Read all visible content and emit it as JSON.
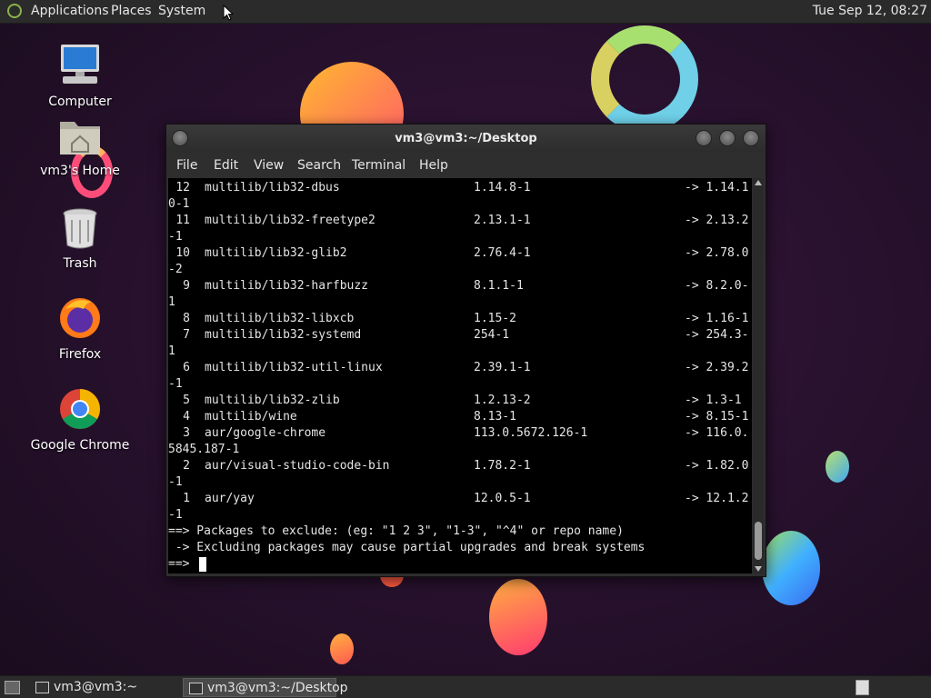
{
  "top_panel": {
    "menus": [
      "Applications",
      "Places",
      "System"
    ],
    "clock": "Tue Sep 12, 08:27"
  },
  "desktop_icons": [
    {
      "label": "Computer",
      "icon": "computer-icon"
    },
    {
      "label": "vm3's Home",
      "icon": "home-folder-icon"
    },
    {
      "label": "Trash",
      "icon": "trash-icon"
    },
    {
      "label": "Firefox",
      "icon": "firefox-icon"
    },
    {
      "label": "Google Chrome",
      "icon": "chrome-icon"
    }
  ],
  "terminal": {
    "title": "vm3@vm3:~/Desktop",
    "menu": [
      "File",
      "Edit",
      "View",
      "Search",
      "Terminal",
      "Help"
    ],
    "lines": [
      {
        "num": "12",
        "pkg": "multilib/lib32-dbus",
        "old": "1.14.8-1",
        "arrow": "-> 1.14.1"
      },
      {
        "text": "0-1"
      },
      {
        "num": "11",
        "pkg": "multilib/lib32-freetype2",
        "old": "2.13.1-1",
        "arrow": "-> 2.13.2"
      },
      {
        "text": "-1"
      },
      {
        "num": "10",
        "pkg": "multilib/lib32-glib2",
        "old": "2.76.4-1",
        "arrow": "-> 2.78.0"
      },
      {
        "text": "-2"
      },
      {
        "num": "9",
        "pkg": "multilib/lib32-harfbuzz",
        "old": "8.1.1-1",
        "arrow": "-> 8.2.0-"
      },
      {
        "text": "1"
      },
      {
        "num": "8",
        "pkg": "multilib/lib32-libxcb",
        "old": "1.15-2",
        "arrow": "-> 1.16-1"
      },
      {
        "num": "7",
        "pkg": "multilib/lib32-systemd",
        "old": "254-1",
        "arrow": "-> 254.3-"
      },
      {
        "text": "1"
      },
      {
        "num": "6",
        "pkg": "multilib/lib32-util-linux",
        "old": "2.39.1-1",
        "arrow": "-> 2.39.2"
      },
      {
        "text": "-1"
      },
      {
        "num": "5",
        "pkg": "multilib/lib32-zlib",
        "old": "1.2.13-2",
        "arrow": "-> 1.3-1"
      },
      {
        "num": "4",
        "pkg": "multilib/wine",
        "old": "8.13-1",
        "arrow": "-> 8.15-1"
      },
      {
        "num": "3",
        "pkg": "aur/google-chrome",
        "old": "113.0.5672.126-1",
        "arrow": "-> 116.0."
      },
      {
        "text": "5845.187-1"
      },
      {
        "num": "2",
        "pkg": "aur/visual-studio-code-bin",
        "old": "1.78.2-1",
        "arrow": "-> 1.82.0"
      },
      {
        "text": "-1"
      },
      {
        "num": "1",
        "pkg": "aur/yay",
        "old": "12.0.5-1",
        "arrow": "-> 12.1.2"
      },
      {
        "text": "-1"
      },
      {
        "text": "==> Packages to exclude: (eg: \"1 2 3\", \"1-3\", \"^4\" or repo name)"
      },
      {
        "text": " -> Excluding packages may cause partial upgrades and break systems"
      },
      {
        "text": "==> ",
        "cursor": true
      }
    ]
  },
  "taskbar": {
    "items": [
      {
        "label": "vm3@vm3:~",
        "active": false
      },
      {
        "label": "vm3@vm3:~/Desktop",
        "active": true
      }
    ]
  },
  "colors": {
    "desktop_bg": "#2a1230",
    "panel_bg": "#2b2b2b",
    "terminal_bg": "#000000",
    "terminal_fg": "#e5e5e5"
  }
}
